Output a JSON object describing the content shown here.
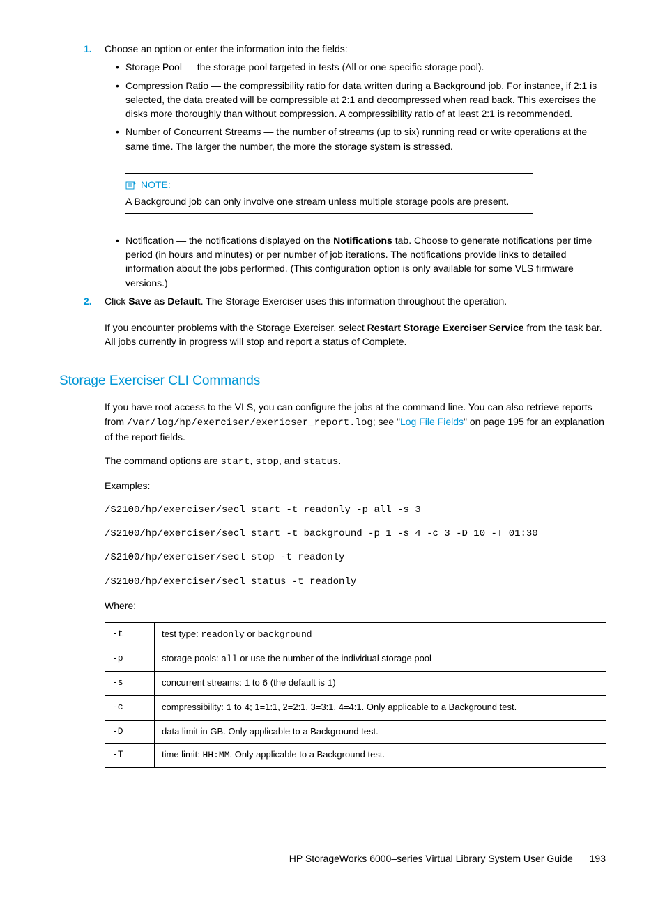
{
  "list1": {
    "num1": "1.",
    "item1_intro": "Choose an option or enter the information into the fields:",
    "sub1": "Storage Pool — the storage pool targeted in tests (All or one specific storage pool).",
    "sub2": "Compression Ratio — the compressibility ratio for data written during a Background job. For instance, if 2:1 is selected, the data created will be compressible at 2:1 and decompressed when read back. This exercises the disks more thoroughly than without compression. A compressibility ratio of at least 2:1 is recommended.",
    "sub3": "Number of Concurrent Streams — the number of streams (up to six) running read or write operations at the same time. The larger the number, the more the storage system is stressed.",
    "note_label": "NOTE:",
    "note_body": "A Background job can only involve one stream unless multiple storage pools are present.",
    "sub4_a": "Notification — the notifications displayed on the ",
    "sub4_b": "Notifications",
    "sub4_c": " tab. Choose to generate notifications per time period (in hours and minutes) or per number of job iterations. The notifications provide links to detailed information about the jobs performed. (This configuration option is only available for some VLS firmware versions.)",
    "num2": "2.",
    "item2_a": "Click ",
    "item2_b": "Save as Default",
    "item2_c": ". The Storage Exerciser uses this information throughout the operation."
  },
  "para1": {
    "a": "If you encounter problems with the Storage Exerciser, select ",
    "b": "Restart Storage Exerciser Service",
    "c": " from the task bar. All jobs currently in progress will stop and report a status of Complete."
  },
  "heading": "Storage Exerciser CLI Commands",
  "para2": {
    "a": "If you have root access to the VLS, you can configure the jobs at the command line. You can also retrieve reports from ",
    "path": "/var/log/hp/exerciser/exericser_report.log",
    "b": "; see \"",
    "link": "Log File Fields",
    "c": "\" on page 195 for an explanation of the report fields."
  },
  "para3": {
    "a": "The command options are ",
    "c1": "start",
    "s1": ", ",
    "c2": "stop",
    "s2": ", and ",
    "c3": "status",
    "s3": "."
  },
  "examples_label": "Examples:",
  "cmd1": "/S2100/hp/exerciser/secl start -t readonly -p all -s 3",
  "cmd2": "/S2100/hp/exerciser/secl start -t background -p 1 -s 4 -c 3 -D 10 -T 01:30",
  "cmd3": "/S2100/hp/exerciser/secl stop -t readonly",
  "cmd4": "/S2100/hp/exerciser/secl status -t readonly",
  "where_label": "Where:",
  "table": {
    "r0": {
      "flag": "-t",
      "a": "test type: ",
      "m1": "readonly",
      "s": " or ",
      "m2": "background"
    },
    "r1": {
      "flag": "-p",
      "a": "storage pools: ",
      "m1": "all",
      "b": " or use the number of the individual storage pool"
    },
    "r2": {
      "flag": "-s",
      "a": "concurrent streams: ",
      "m1": "1",
      "s": " to ",
      "m2": "6",
      "b": " (the default is ",
      "m3": "1",
      "c": ")"
    },
    "r3": {
      "flag": "-c",
      "a": "compressibility: ",
      "m1": "1",
      "s": " to ",
      "m2": "4",
      "b": "; 1=1:1, 2=2:1, 3=3:1, 4=4:1. Only applicable to a Background test."
    },
    "r4": {
      "flag": "-D",
      "a": "data limit in GB. Only applicable to a Background test."
    },
    "r5": {
      "flag": "-T",
      "a": "time limit: ",
      "m1": "HH:MM",
      "b": ". Only applicable to a Background test."
    }
  },
  "footer": {
    "title": "HP StorageWorks 6000–series Virtual Library System User Guide",
    "page": "193"
  }
}
